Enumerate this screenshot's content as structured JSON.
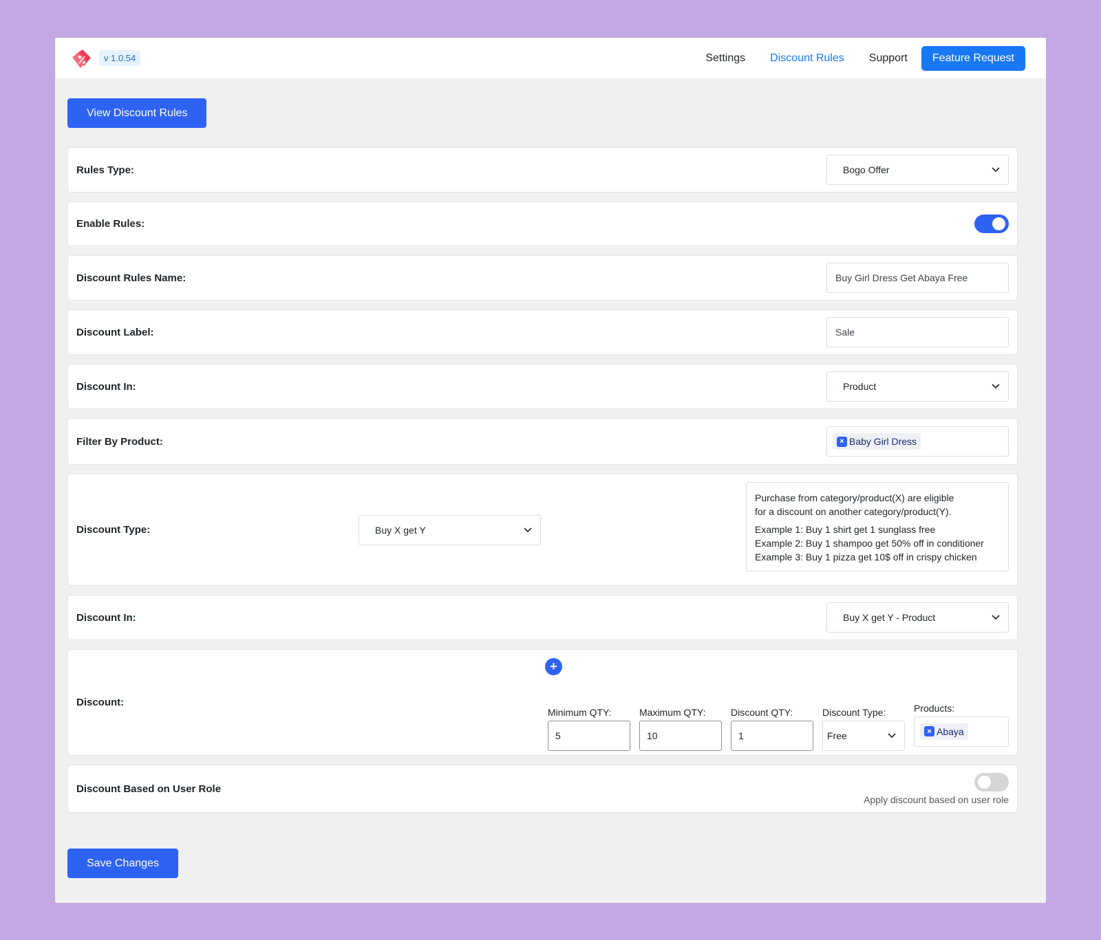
{
  "header": {
    "version": "v 1.0.54",
    "nav": [
      {
        "label": "Settings"
      },
      {
        "label": "Discount Rules"
      },
      {
        "label": "Support"
      }
    ],
    "feature_request": "Feature Request",
    "active_color": "#1877f2",
    "logo_icon": "price-tag-icon"
  },
  "view_button": "View Discount Rules",
  "form": {
    "rules_type": {
      "label": "Rules Type:",
      "value": "Bogo Offer"
    },
    "enable_rules": {
      "label": "Enable Rules:",
      "enabled": true
    },
    "rules_name": {
      "label": "Discount Rules Name:",
      "value": "Buy Girl Dress Get Abaya Free"
    },
    "discount_label": {
      "label": "Discount Label:",
      "value": "Sale"
    },
    "discount_in": {
      "label": "Discount In:",
      "value": "Product"
    },
    "filter_by_product": {
      "label": "Filter By Product:",
      "tag": "Baby Girl Dress"
    },
    "discount_type": {
      "label": "Discount Type:",
      "value": "Buy X get Y",
      "info_line1": "Purchase from category/product(X) are eligible",
      "info_line2": "for a discount on another category/product(Y).",
      "example1": "Example 1: Buy 1 shirt get 1 sunglass free",
      "example2": "Example 2: Buy 1 shampoo get 50% off in conditioner",
      "example3": "Example 3: Buy 1 pizza get 10$ off in crispy chicken"
    },
    "discount_in_2": {
      "label": "Discount In:",
      "value": "Buy X get Y - Product"
    },
    "discount": {
      "label": "Discount:",
      "min_qty_label": "Minimum QTY:",
      "min_qty": "5",
      "max_qty_label": "Maximum QTY:",
      "max_qty": "10",
      "discount_qty_label": "Discount QTY:",
      "discount_qty": "1",
      "discount_type_label": "Discount Type:",
      "discount_type": "Free",
      "products_label": "Products:",
      "product_tag": "Abaya"
    },
    "user_role": {
      "label": "Discount Based on User Role",
      "enabled": false,
      "hint": "Apply discount based on user role"
    }
  },
  "save_button": "Save Changes"
}
